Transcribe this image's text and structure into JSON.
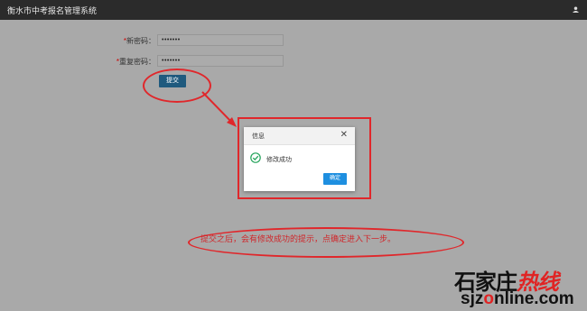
{
  "app": {
    "title": "衡水市中考报名管理系统"
  },
  "form": {
    "new_password": {
      "required_mark": "*",
      "label": "新密码：",
      "value": "•••••••"
    },
    "confirm_password": {
      "required_mark": "*",
      "label": "重复密码：",
      "value": "•••••••"
    },
    "submit_label": "提交"
  },
  "dialog": {
    "title": "信息",
    "close_glyph": "✕",
    "message": "修改成功",
    "ok_label": "确定",
    "success_color": "#23a35a"
  },
  "annotation": {
    "note": "提交之后，会有修改成功的提示，点确定进入下一步。",
    "color": "#e0272b"
  },
  "watermark": {
    "cn_main": "石家庄",
    "cn_hot": "热线",
    "url_prefix": "sjz",
    "url_accent": "o",
    "url_suffix": "nline.com"
  }
}
